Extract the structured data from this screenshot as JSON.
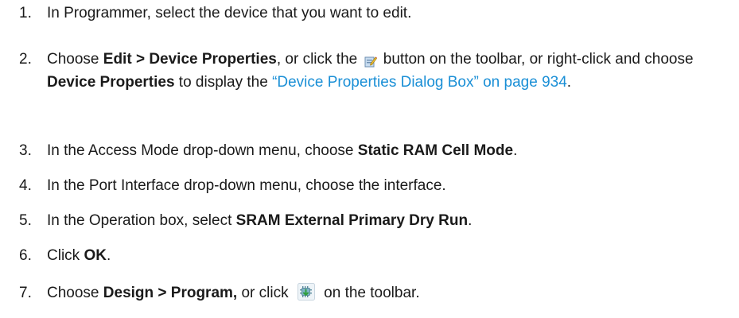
{
  "steps": [
    {
      "num": "1.",
      "parts": [
        "In Programmer, select the device that you want to edit."
      ]
    },
    {
      "num": "2.",
      "parts": [
        "Choose ",
        "Edit > Device Properties",
        ", or click the ",
        " button on the toolbar, or right-click and choose ",
        "Device Properties",
        " to display the ",
        "“Device Properties Dialog Box” on page 934",
        "."
      ]
    },
    {
      "num": "3.",
      "parts": [
        "In the Access Mode drop-down menu, choose ",
        "Static RAM Cell Mode",
        "."
      ]
    },
    {
      "num": "4.",
      "parts": [
        "In the Port Interface drop-down menu, choose the interface."
      ]
    },
    {
      "num": "5.",
      "parts": [
        "In the Operation box, select ",
        "SRAM External Primary Dry Run",
        "."
      ]
    },
    {
      "num": "6.",
      "parts": [
        "Click ",
        "OK",
        "."
      ]
    },
    {
      "num": "7.",
      "parts": [
        "Choose ",
        "Design > Program,",
        " or click ",
        " on the toolbar."
      ]
    }
  ],
  "icons": {
    "edit": "device-properties-icon",
    "program": "program-icon"
  },
  "colors": {
    "text": "#1a1a1a",
    "link": "#1a8fd6"
  }
}
